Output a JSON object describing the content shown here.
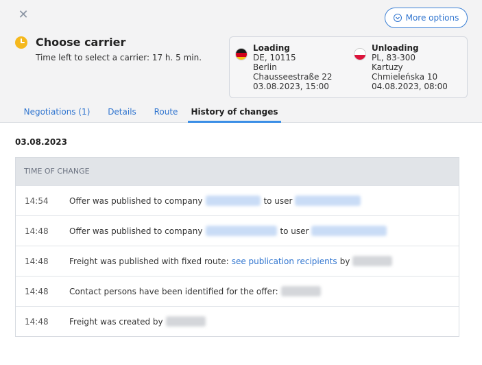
{
  "header": {
    "close_icon": "close-icon",
    "more_options_label": "More options",
    "title": "Choose carrier",
    "subtitle": "Time left to select a carrier: 17 h. 5 min.",
    "accent_color": "#f5b81d"
  },
  "route": {
    "loading": {
      "label": "Loading",
      "flag": "germany-flag",
      "address": "DE, 10115",
      "city": "Berlin",
      "street": "Chausseestraße 22",
      "datetime": "03.08.2023, 15:00"
    },
    "unloading": {
      "label": "Unloading",
      "flag": "poland-flag",
      "address": "PL, 83-300",
      "city": "Kartuzy",
      "street": "Chmieleńska 10",
      "datetime": "04.08.2023, 08:00"
    }
  },
  "tabs": [
    {
      "label": "Negotiations (1)",
      "active": false
    },
    {
      "label": "Details",
      "active": false
    },
    {
      "label": "Route",
      "active": false
    },
    {
      "label": "History of changes",
      "active": true
    }
  ],
  "history": {
    "date": "03.08.2023",
    "column_header": "TIME OF CHANGE",
    "rows": [
      {
        "time": "14:54",
        "text": "Offer was published to company",
        "mid": "to user"
      },
      {
        "time": "14:48",
        "text": "Offer was published to company",
        "mid": "to user"
      },
      {
        "time": "14:48",
        "text": "Freight was published with fixed route:",
        "link": "see publication recipients",
        "mid": "by"
      },
      {
        "time": "14:48",
        "text": "Contact persons have been identified for the offer:"
      },
      {
        "time": "14:48",
        "text": "Freight was created by"
      }
    ]
  },
  "colors": {
    "link": "#2f74cf",
    "tab_underline": "#3a8ee6",
    "header_bg": "#f3f3f4"
  }
}
